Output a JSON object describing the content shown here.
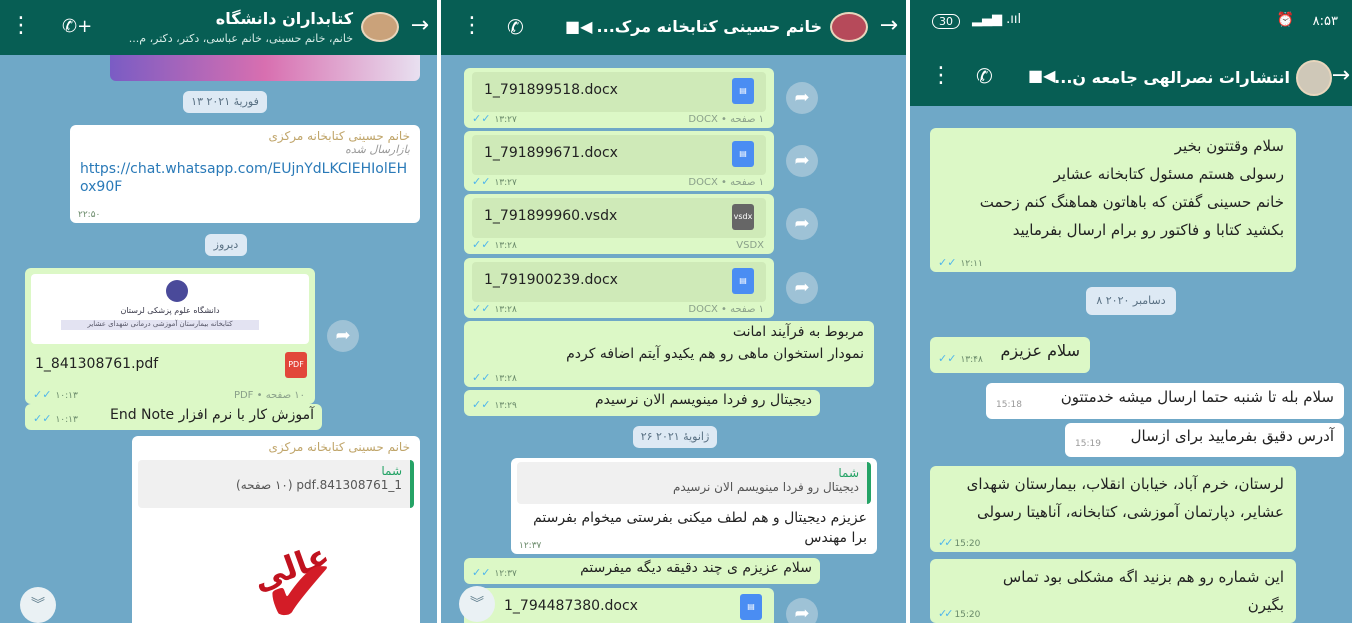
{
  "panel1": {
    "header": {
      "title": "کتابداران دانشگاه",
      "subtitle": "خانم، خانم حسینی، خانم عباسی، دکتر، دکتر، م..."
    },
    "date1": "۱۳ فوریهٔ ۲۰۲۱",
    "link_msg": {
      "sender": "خانم حسینی کتابخانه مرکزی",
      "forwarded": "بازارسال شده",
      "url": "https://chat.whatsapp.com/EUjnYdLKCIEHIolEHox90F",
      "time": "۲۲:۵۰"
    },
    "date2": "دیروز",
    "pdf_msg": {
      "filename": "1_841308761.pdf",
      "meta": "۱۰ صفحه • PDF",
      "time": "۱۰:۱۳",
      "preview_title": "دانشگاه علوم پزشکی لرستان",
      "preview_sub": "کتابخانه بیمارستان آموزشی درمانی شهدای عشایر"
    },
    "text_msg": {
      "text": "آموزش کار با نرم افزار End Note",
      "time": "۱۰:۱۳"
    },
    "reply_msg": {
      "sender": "خانم حسینی کتابخانه مرکزی",
      "quote_author": "شما",
      "quote_text": "1_841308761.pdf (۱۰ صفحه)",
      "sticker_text": "عالی"
    }
  },
  "panel2": {
    "header": {
      "title": "خانم حسینی کتابخانه مرک..."
    },
    "docs": [
      {
        "name": "1_791899518.docx",
        "meta": "۱ صفحه • DOCX",
        "time": "۱۳:۲۷",
        "icon": "docx"
      },
      {
        "name": "1_791899671.docx",
        "meta": "۱ صفحه • DOCX",
        "time": "۱۳:۲۷",
        "icon": "docx"
      },
      {
        "name": "1_791899960.vsdx",
        "meta": "VSDX",
        "time": "۱۳:۲۸",
        "icon": "vsdx"
      },
      {
        "name": "1_791900239.docx",
        "meta": "۱ صفحه • DOCX",
        "time": "۱۳:۲۸",
        "icon": "docx"
      }
    ],
    "msg1": {
      "text": "مربوط به فرآیند امانت\nنمودار استخوان ماهی رو هم یکیدو آیتم اضافه کردم",
      "time": "۱۳:۲۸"
    },
    "msg2": {
      "text": "دیجیتال رو فردا مینویسم الان نرسیدم",
      "time": "۱۳:۲۹"
    },
    "date1": "۲۶ ژانویهٔ ۲۰۲۱",
    "reply": {
      "quote_author": "شما",
      "quote_text": "دیجیتال رو فردا مینویسم الان نرسیدم",
      "text": "عزیزم دیجیتال و هم لطف میکنی بفرستی میخوام بفرستم برا مهندس",
      "time": "۱۲:۳۷"
    },
    "msg3": {
      "text": "سلام عزیزم ی چند دقیقه دیگه میفرستم",
      "time": "۱۲:۳۷"
    },
    "last_doc": {
      "name": "1_794487380.docx"
    }
  },
  "panel3": {
    "status": {
      "left": "۸:۵۳",
      "battery": "30"
    },
    "header": {
      "title": "انتشارات نصرالهی جامعه ن..."
    },
    "msg1": {
      "lines": [
        "سلام وقتتون بخیر",
        "رسولی هستم مسئول کتابخانه عشایر",
        "خانم حسینی گفتن که باهاتون هماهنگ کنم زحمت",
        "بکشید کتابا و فاکتور رو برام ارسال بفرمایید"
      ],
      "time": "۱۲:۱۱"
    },
    "date1": "۸ دسامبر ۲۰۲۰",
    "msg2": {
      "text": "سلام عزیزم",
      "time": "۱۳:۴۸"
    },
    "in1": {
      "text": "سلام بله تا شنبه حتما ارسال میشه خدمتتون",
      "time": "15:18"
    },
    "in2": {
      "text": "آدرس دقیق بفرمایید برای ازسال",
      "time": "15:19"
    },
    "msg3": {
      "lines": [
        "لرستان، خرم آباد، خیابان انقلاب، بیمارستان شهدای",
        "عشایر، دپارتمان آموزشی، کتابخانه، آناهیتا رسولی"
      ],
      "time": "15:20"
    },
    "msg4": {
      "lines": [
        "این شماره رو هم بزنید اگه مشکلی بود تماس",
        "بگیرن"
      ],
      "time": "15:20"
    }
  }
}
